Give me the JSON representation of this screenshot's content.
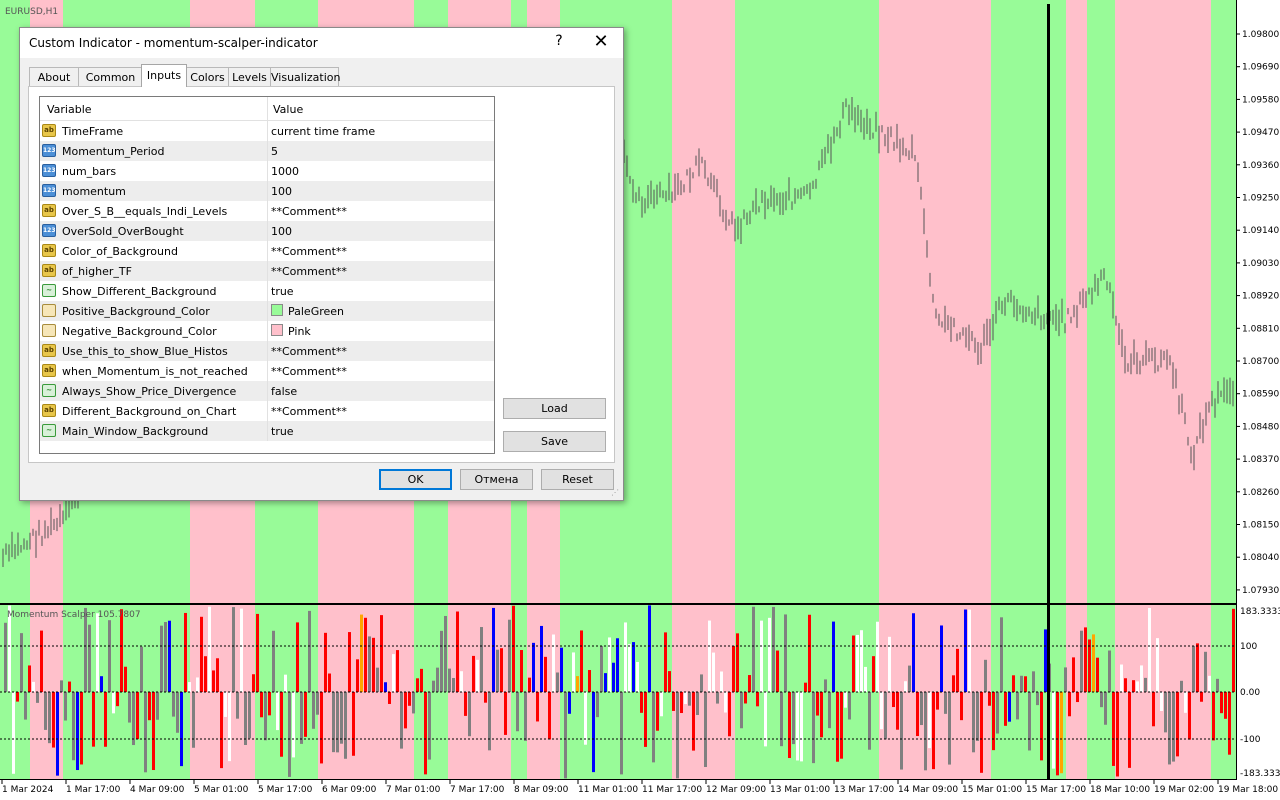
{
  "chart": {
    "symbol": "EURUSD,H1",
    "indicator_label": "Momentum Scalper 105.7807",
    "price_axis": [
      "1.09800",
      "1.09690",
      "1.09580",
      "1.09470",
      "1.09360",
      "1.09250",
      "1.09140",
      "1.09030",
      "1.08920",
      "1.08810",
      "1.08700",
      "1.08590",
      "1.08480",
      "1.08370",
      "1.08260",
      "1.08150",
      "1.08040",
      "1.07930"
    ],
    "indicator_axis": {
      "top": "183.3333",
      "upper": "100",
      "zero": "0.00",
      "lower": "-100",
      "bottom": "-183.3333"
    },
    "time_axis": [
      "1 Mar 2024",
      "1 Mar 17:00",
      "4 Mar 09:00",
      "5 Mar 01:00",
      "5 Mar 17:00",
      "6 Mar 09:00",
      "7 Mar 01:00",
      "7 Mar 17:00",
      "8 Mar 09:00",
      "11 Mar 01:00",
      "11 Mar 17:00",
      "12 Mar 09:00",
      "13 Mar 01:00",
      "13 Mar 17:00",
      "14 Mar 09:00",
      "15 Mar 01:00",
      "15 Mar 17:00",
      "18 Mar 10:00",
      "19 Mar 02:00",
      "19 Mar 18:00"
    ],
    "colors": {
      "positive": "#98fb98",
      "negative": "#ffc0cb",
      "up_histo": "#ff0000",
      "down_histo": "#0000ff",
      "neutral_histo": "#808080",
      "signal": "#ffa500",
      "candles": "#555555"
    }
  },
  "dialog": {
    "title": "Custom Indicator - momentum-scalper-indicator",
    "help": "?",
    "close": "✕",
    "tabs": [
      "About",
      "Common",
      "Inputs",
      "Colors",
      "Levels",
      "Visualization"
    ],
    "active_tab": "Inputs",
    "columns": {
      "variable": "Variable",
      "value": "Value"
    },
    "params": [
      {
        "type": "ab",
        "name": "TimeFrame",
        "value": "current time frame"
      },
      {
        "type": "num",
        "name": "Momentum_Period",
        "value": "5"
      },
      {
        "type": "num",
        "name": "num_bars",
        "value": "1000"
      },
      {
        "type": "num",
        "name": "momentum",
        "value": "100"
      },
      {
        "type": "ab",
        "name": "Over_S_B__equals_Indi_Levels",
        "value": "**Comment**"
      },
      {
        "type": "num",
        "name": "OverSold_OverBought",
        "value": "100"
      },
      {
        "type": "ab",
        "name": "Color_of_Background",
        "value": "**Comment**"
      },
      {
        "type": "ab",
        "name": "of_higher_TF",
        "value": "**Comment**"
      },
      {
        "type": "bool",
        "name": "Show_Different_Background",
        "value": "true"
      },
      {
        "type": "color",
        "name": "Positive_Background_Color",
        "value": "PaleGreen",
        "swatch": "#98fb98"
      },
      {
        "type": "color",
        "name": "Negative_Background_Color",
        "value": "Pink",
        "swatch": "#ffc0cb"
      },
      {
        "type": "ab",
        "name": "Use_this_to_show_Blue_Histos",
        "value": "**Comment**"
      },
      {
        "type": "ab",
        "name": "when_Momentum_is_not_reached",
        "value": "**Comment**"
      },
      {
        "type": "bool",
        "name": "Always_Show_Price_Divergence",
        "value": "false"
      },
      {
        "type": "ab",
        "name": "Different_Background_on_Chart",
        "value": "**Comment**"
      },
      {
        "type": "bool",
        "name": "Main_Window_Background",
        "value": "true"
      }
    ],
    "buttons": {
      "load": "Load",
      "save": "Save",
      "ok": "OK",
      "cancel": "Отмена",
      "reset": "Reset"
    }
  }
}
